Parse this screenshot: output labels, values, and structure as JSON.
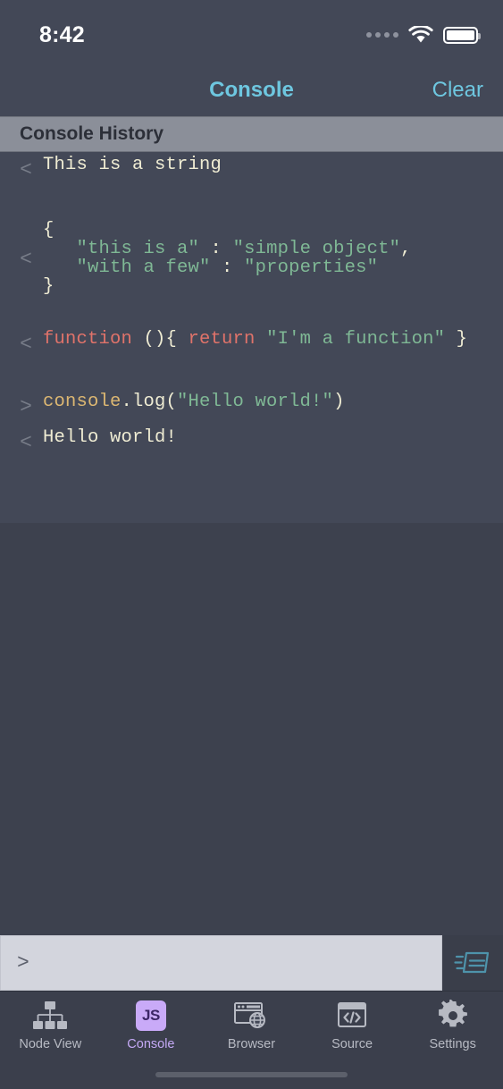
{
  "status_bar": {
    "time": "8:42",
    "signal_icon": "cellular-dots-icon",
    "wifi_icon": "wifi-icon",
    "battery_icon": "battery-full-icon"
  },
  "nav_bar": {
    "title": "Console",
    "clear_label": "Clear",
    "accent_color": "#6ec7e0"
  },
  "section_header": {
    "title": "Console History",
    "background": "#8b8f99"
  },
  "console": {
    "input_marker": ">",
    "output_marker": "<",
    "entries": [
      {
        "type": "output",
        "marker": "<",
        "tokens": [
          {
            "t": "This is a string",
            "c": "plain"
          }
        ]
      },
      {
        "type": "output",
        "marker": "<",
        "tokens": [
          {
            "t": "{\n   ",
            "c": "plain"
          },
          {
            "t": "\"this is a\"",
            "c": "string"
          },
          {
            "t": " : ",
            "c": "plain"
          },
          {
            "t": "\"simple object\"",
            "c": "string"
          },
          {
            "t": ",\n   ",
            "c": "plain"
          },
          {
            "t": "\"with a few\"",
            "c": "string"
          },
          {
            "t": " : ",
            "c": "plain"
          },
          {
            "t": "\"properties\"",
            "c": "string"
          },
          {
            "t": "\n}",
            "c": "plain"
          }
        ]
      },
      {
        "type": "output",
        "marker": "<",
        "tokens": [
          {
            "t": "function",
            "c": "keyword"
          },
          {
            "t": " (){ ",
            "c": "plain"
          },
          {
            "t": "return",
            "c": "keyword"
          },
          {
            "t": " ",
            "c": "plain"
          },
          {
            "t": "\"I'm a function\"",
            "c": "string"
          },
          {
            "t": " }",
            "c": "plain"
          }
        ]
      },
      {
        "type": "input",
        "marker": ">",
        "tokens": [
          {
            "t": "console",
            "c": "object"
          },
          {
            "t": ".log(",
            "c": "plain"
          },
          {
            "t": "\"Hello world!\"",
            "c": "string"
          },
          {
            "t": ")",
            "c": "plain"
          }
        ]
      },
      {
        "type": "output",
        "marker": "<",
        "tokens": [
          {
            "t": "Hello world!",
            "c": "plain"
          }
        ]
      }
    ],
    "colors": {
      "plain": "#efecd3",
      "string": "#7fb895",
      "keyword": "#e0736a",
      "object": "#dcb772",
      "marker": "#777c88",
      "background": "#434857"
    }
  },
  "input_bar": {
    "prompt": ">",
    "value": "",
    "placeholder": "",
    "send_icon": "send-message-icon",
    "send_icon_color": "#4e93ab",
    "field_background": "#d3d5dd"
  },
  "tab_bar": {
    "active_color": "#c4a9f5",
    "inactive_color": "#b7bac3",
    "tabs": [
      {
        "label": "Node View",
        "icon": "node-tree-icon",
        "active": false
      },
      {
        "label": "Console",
        "icon": "js-badge-icon",
        "active": true
      },
      {
        "label": "Browser",
        "icon": "browser-globe-icon",
        "active": false
      },
      {
        "label": "Source",
        "icon": "code-tags-icon",
        "active": false
      },
      {
        "label": "Settings",
        "icon": "gear-icon",
        "active": false
      }
    ]
  },
  "home_indicator": {
    "icon": "home-indicator-bar"
  }
}
